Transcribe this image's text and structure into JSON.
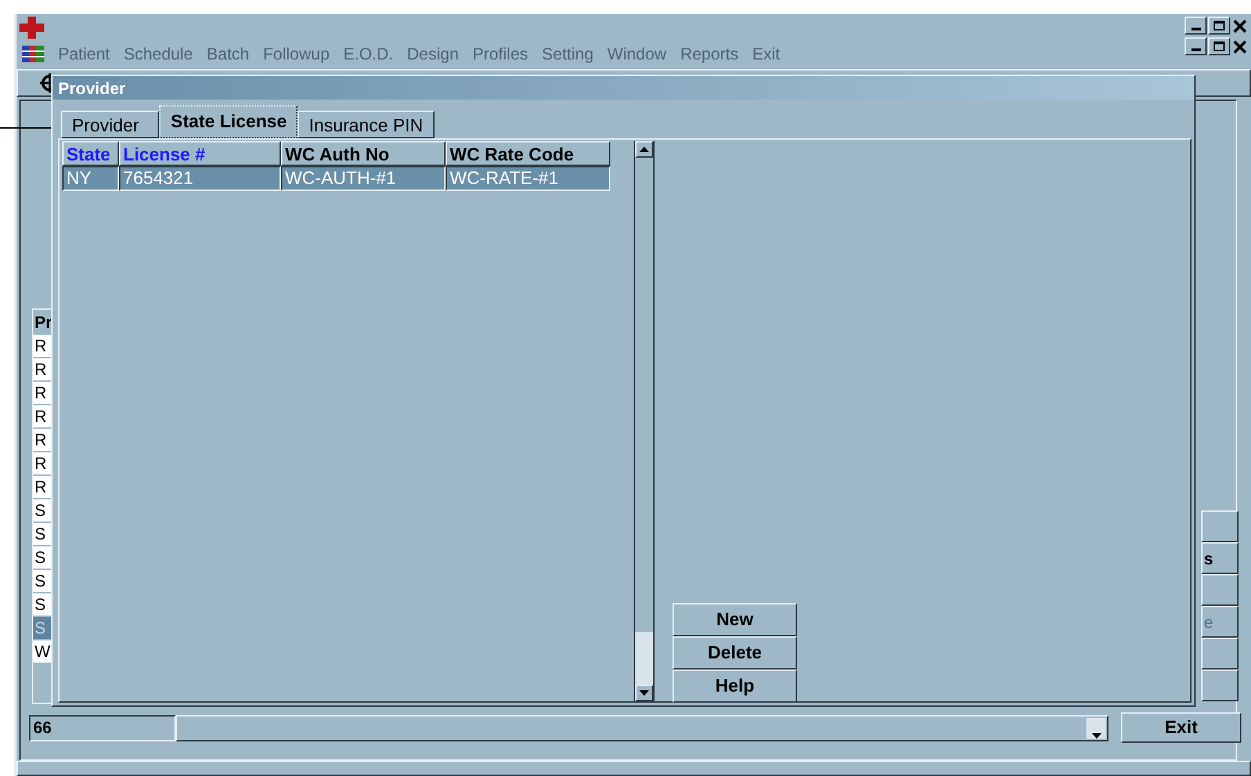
{
  "menu_bar": {
    "items": [
      "Patient",
      "Schedule",
      "Batch",
      "Followup",
      "E.O.D.",
      "Design",
      "Profiles",
      "Setting",
      "Window",
      "Reports",
      "Exit"
    ]
  },
  "background_window": {
    "list_header": "Pr",
    "list_items": [
      {
        "text": "R",
        "selected": false
      },
      {
        "text": "R",
        "selected": false
      },
      {
        "text": "R",
        "selected": false
      },
      {
        "text": "R",
        "selected": false
      },
      {
        "text": "R",
        "selected": false
      },
      {
        "text": "R",
        "selected": false
      },
      {
        "text": "R",
        "selected": false
      },
      {
        "text": "S",
        "selected": false
      },
      {
        "text": "S",
        "selected": false
      },
      {
        "text": "S",
        "selected": false
      },
      {
        "text": "S",
        "selected": false
      },
      {
        "text": "S",
        "selected": false
      },
      {
        "text": "S",
        "selected": true
      },
      {
        "text": "W",
        "selected": false
      }
    ],
    "side_buttons": [
      {
        "kind": "blank"
      },
      {
        "kind": "labeled",
        "text": "s",
        "disabled": false
      },
      {
        "kind": "blank"
      },
      {
        "kind": "labeled",
        "text": "e",
        "disabled": true
      },
      {
        "kind": "blank"
      },
      {
        "kind": "blank"
      }
    ],
    "count": "66",
    "exit_button": {
      "label": "Exit"
    }
  },
  "dialog": {
    "title": "Provider",
    "tabs": [
      {
        "label": "Provider",
        "selected": false
      },
      {
        "label": "State License",
        "selected": true
      },
      {
        "label": "Insurance PIN",
        "selected": false
      }
    ],
    "table": {
      "columns": [
        {
          "label": "State",
          "kind": "key"
        },
        {
          "label": "License #",
          "kind": "key"
        },
        {
          "label": "WC Auth No",
          "kind": "plain"
        },
        {
          "label": "WC Rate Code",
          "kind": "plain"
        }
      ],
      "rows": [
        {
          "cells": [
            "NY",
            "7654321",
            "WC-AUTH-#1",
            "WC-RATE-#1"
          ],
          "selected": true
        }
      ]
    },
    "buttons": [
      {
        "label": "New"
      },
      {
        "label": "Delete"
      },
      {
        "label": "Help"
      }
    ]
  }
}
